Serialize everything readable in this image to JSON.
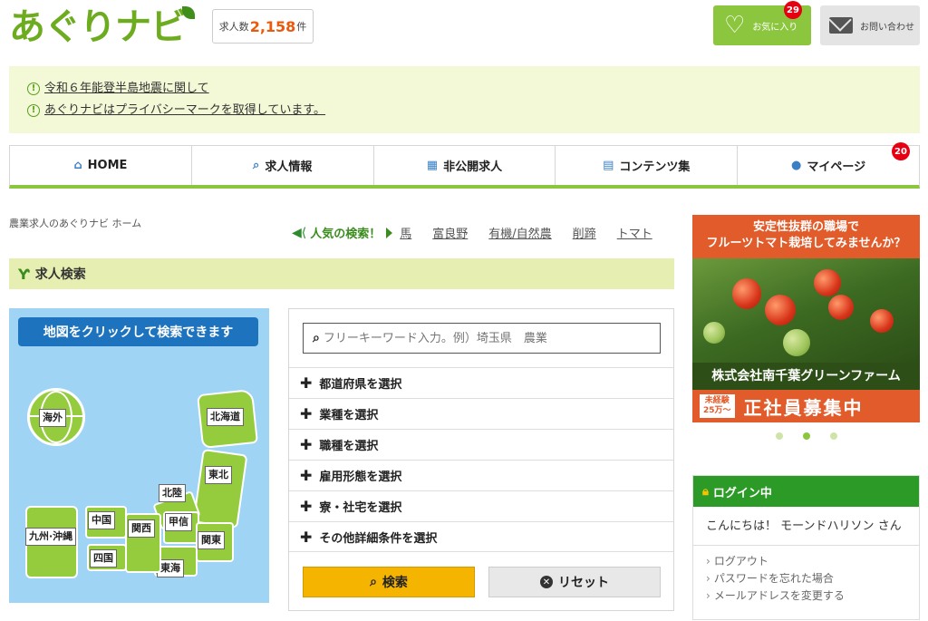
{
  "header": {
    "logo": "あぐりナビ",
    "job_count_label": "求人数",
    "job_count_value": "2,158",
    "job_count_unit": "件",
    "favorite_label": "お気に入り",
    "favorite_badge": "29",
    "contact_label": "お問い合わせ"
  },
  "notices": [
    "令和６年能登半島地震に関して",
    "あぐりナビはプライバシーマークを取得しています。"
  ],
  "nav": {
    "home": "HOME",
    "jobs": "求人情報",
    "private": "非公開求人",
    "contents": "コンテンツ集",
    "mypage": "マイページ",
    "mypage_badge": "20"
  },
  "breadcrumb": "農業求人のあぐりナビ ホーム",
  "popular": {
    "label": "人気の検索！",
    "items": [
      "馬",
      "富良野",
      "有機/自然農",
      "削蹄",
      "トマト"
    ]
  },
  "search": {
    "section_title": "求人検索",
    "map_heading": "地図をクリックして検索できます",
    "regions": {
      "overseas": "海外",
      "hokkaido": "北海道",
      "tohoku": "東北",
      "hokuriku": "北陸",
      "koshin": "甲信",
      "kanto": "関東",
      "tokai": "東海",
      "kansai": "関西",
      "chugoku": "中国",
      "shikoku": "四国",
      "kyushu": "九州·沖縄"
    },
    "keyword_placeholder": "フリーキーワード入力。例）埼玉県　農業",
    "filters": [
      "都道府県を選択",
      "業種を選択",
      "職種を選択",
      "雇用形態を選択",
      "寮・社宅を選択",
      "その他詳細条件を選択"
    ],
    "search_button": "検索",
    "reset_button": "リセット"
  },
  "banner": {
    "line1": "安定性抜群の職場で",
    "line2": "フルーツトマト栽培してみませんか？",
    "company": "株式会社南千葉グリーンファーム",
    "salary1": "未経験",
    "salary2": "25万〜",
    "hiring": "正社員募集中",
    "slide_active": 2,
    "slide_count": 3
  },
  "login": {
    "heading": "ログイン中",
    "greeting": "こんにちは！ モーンドハリソン さん",
    "links": [
      "ログアウト",
      "パスワードを忘れた場合",
      "メールアドレスを変更する"
    ]
  },
  "colors": {
    "brand_green": "#8cc63f",
    "accent_orange": "#e95a0c",
    "badge_red": "#e60012",
    "map_sea": "#9fd4f5",
    "search_yellow": "#f4b400",
    "login_green": "#2b9a26"
  }
}
